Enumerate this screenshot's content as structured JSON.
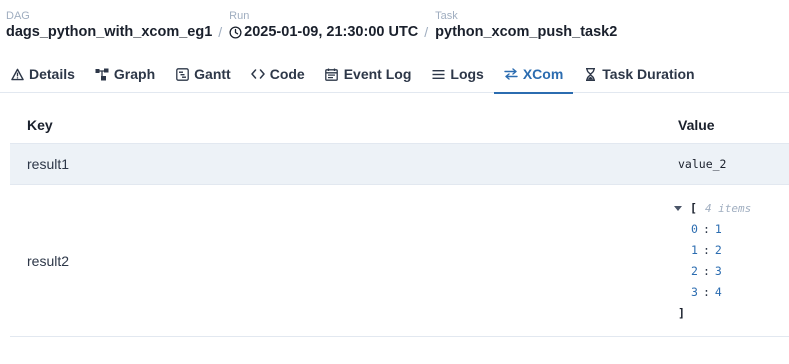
{
  "breadcrumb": {
    "dag": {
      "label": "DAG",
      "value": "dags_python_with_xcom_eg1"
    },
    "run": {
      "label": "Run",
      "value": "2025-01-09, 21:30:00 UTC"
    },
    "task": {
      "label": "Task",
      "value": "python_xcom_push_task2"
    },
    "separator": "/"
  },
  "tabs": [
    {
      "label": "Details",
      "icon": "warning-triangle-icon"
    },
    {
      "label": "Graph",
      "icon": "graph-icon"
    },
    {
      "label": "Gantt",
      "icon": "gantt-icon"
    },
    {
      "label": "Code",
      "icon": "code-icon"
    },
    {
      "label": "Event Log",
      "icon": "event-log-icon"
    },
    {
      "label": "Logs",
      "icon": "logs-icon"
    },
    {
      "label": "XCom",
      "icon": "swap-arrows-icon",
      "active": true
    },
    {
      "label": "Task Duration",
      "icon": "hourglass-icon"
    }
  ],
  "accent_color": "#2b6cb0",
  "table": {
    "headers": {
      "key": "Key",
      "value": "Value"
    },
    "rows": [
      {
        "key": "result1",
        "value": "value_2"
      },
      {
        "key": "result2",
        "json": {
          "open": "[",
          "close": "]",
          "count_label": "4 items",
          "items": [
            {
              "index": "0",
              "value": "1"
            },
            {
              "index": "1",
              "value": "2"
            },
            {
              "index": "2",
              "value": "3"
            },
            {
              "index": "3",
              "value": "4"
            }
          ]
        }
      }
    ]
  }
}
